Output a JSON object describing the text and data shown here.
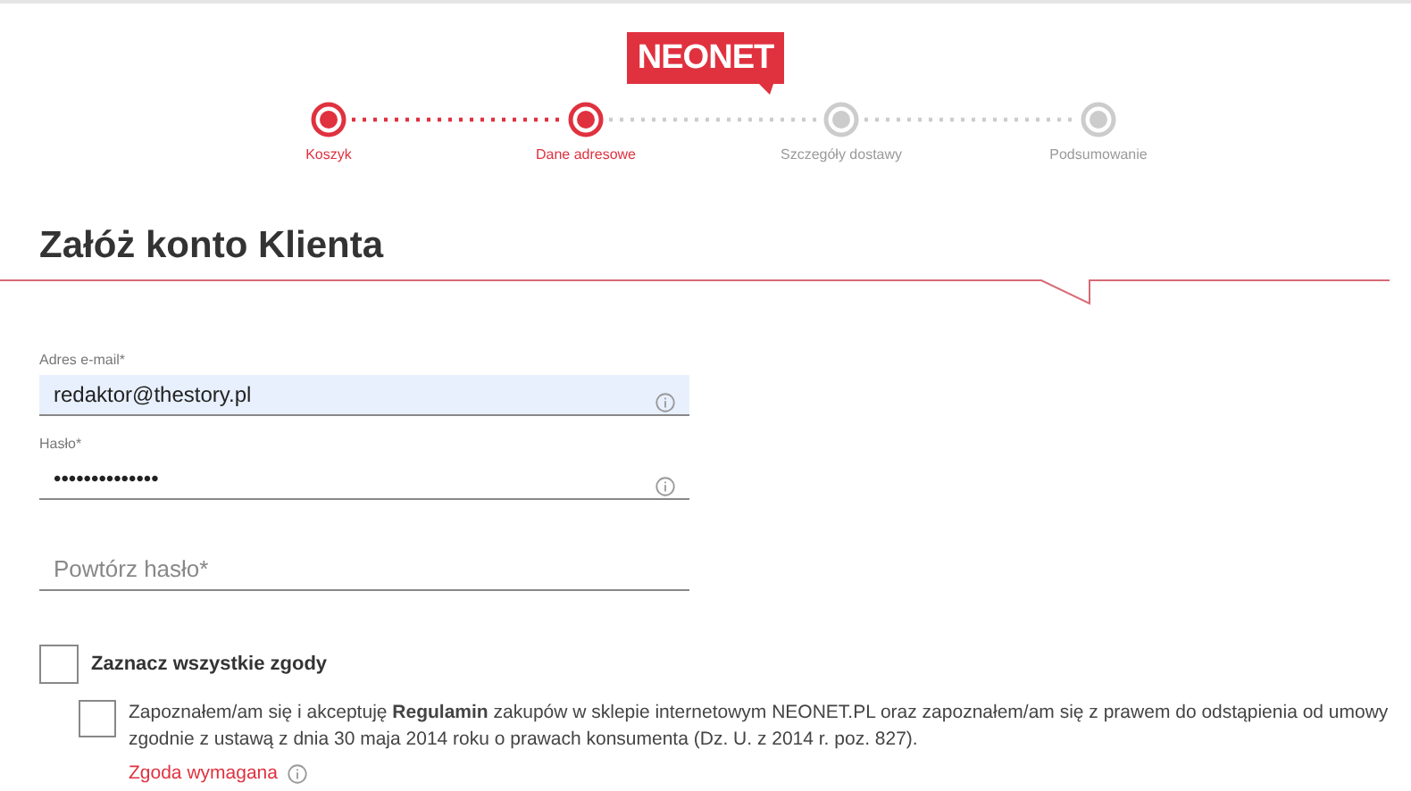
{
  "logo": {
    "text": "NEONET"
  },
  "steps": [
    {
      "label": "Koszyk",
      "active": true
    },
    {
      "label": "Dane adresowe",
      "active": true
    },
    {
      "label": "Szczegóły dostawy",
      "active": false
    },
    {
      "label": "Podsumowanie",
      "active": false
    }
  ],
  "title": "Załóż konto Klienta",
  "fields": [
    {
      "label": "Adres e-mail*",
      "value": "redaktor@thestory.pl",
      "autofilled": true,
      "info": true
    },
    {
      "label": "Hasło*",
      "value": "••••••••••••••",
      "autofilled": false,
      "info": true
    },
    {
      "placeholder": "Powtórz hasło*",
      "autofilled": false,
      "info": false
    }
  ],
  "consent_all": {
    "label": "Zaznacz wszystkie zgody",
    "checked": false
  },
  "consents": [
    {
      "text": "Zapoznałem/am się i akceptuję **Regulamin** zakupów w sklepie internetowym NEONET.PL oraz zapoznałem/am się z prawem do odstąpienia od umowy zgodnie z ustawą z dnia 30 maja 2014 roku o prawach konsumenta (Dz. U. z 2014 r. poz. 827).",
      "checked": false,
      "required_note": "Zgoda wymagana"
    }
  ]
}
